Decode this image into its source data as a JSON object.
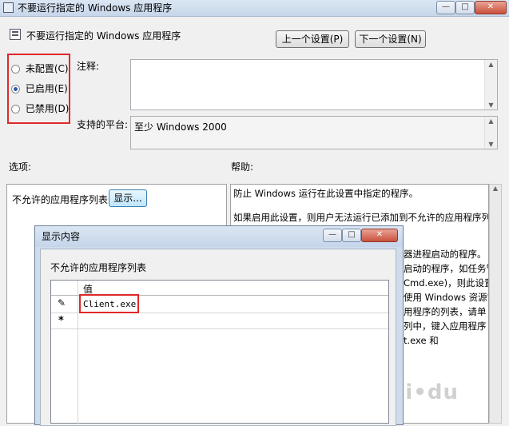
{
  "window": {
    "title": "不要运行指定的 Windows 应用程序",
    "policy_name": "不要运行指定的 Windows 应用程序",
    "prev_button": "上一个设置(P)",
    "next_button": "下一个设置(N)",
    "minimize": "—",
    "maximize": "□",
    "close": "✕"
  },
  "states": {
    "not_configured": "未配置(C)",
    "enabled": "已启用(E)",
    "disabled": "已禁用(D)",
    "selected": "enabled"
  },
  "comment": {
    "label": "注释:",
    "value": ""
  },
  "platform": {
    "label": "支持的平台:",
    "value": "至少 Windows 2000"
  },
  "options": {
    "header": "选项:",
    "list_label": "不允许的应用程序列表",
    "show_button": "显示..."
  },
  "help": {
    "header": "帮助:",
    "lines": [
      "防止 Windows 运行在此设置中指定的程序。",
      "如果启用此设置，则用户无法运行已添加到不允许的应用程序列表",
      "器进程启动的程序。",
      "启动的程序，如任务管",
      "Cmd.exe)，则此设置",
      "使用 Windows 资源管",
      "用程序的列表，请单",
      "列中，键入应用程序",
      "t.exe 和"
    ]
  },
  "dialog": {
    "title": "显示内容",
    "list_label": "不允许的应用程序列表",
    "column_header": "值",
    "rows": [
      {
        "marker": "✎",
        "value": "Client.exe"
      },
      {
        "marker": "*",
        "value": ""
      }
    ]
  },
  "colors": {
    "highlight": "#e0282a",
    "accent": "#2a5caa"
  }
}
